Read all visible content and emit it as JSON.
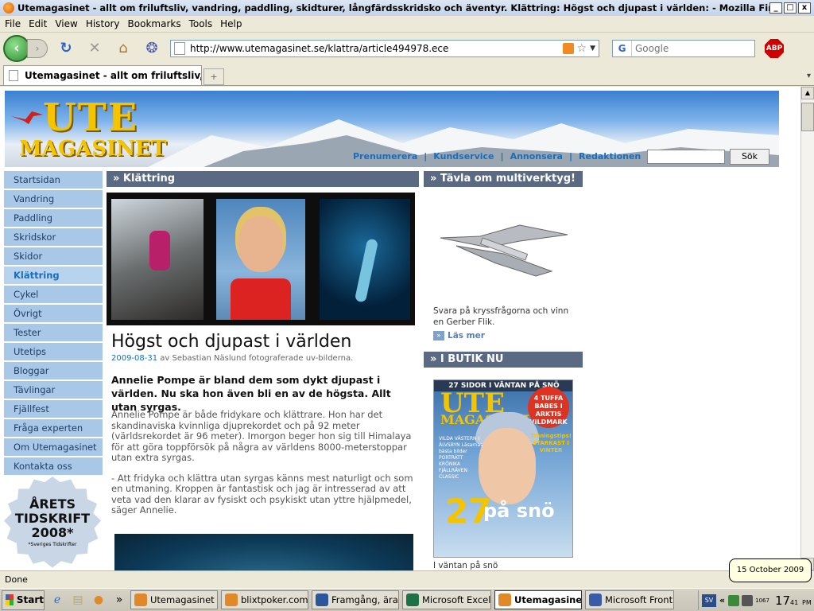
{
  "window": {
    "title": "Utemagasinet - allt om friluftsliv, vandring, paddling, skidturer, långfärdsskridsko och äventyr. Klättring: Högst och djupast i världen: - Mozilla Firefox",
    "controls": [
      "_",
      "□",
      "x"
    ]
  },
  "menu": [
    "File",
    "Edit",
    "View",
    "History",
    "Bookmarks",
    "Tools",
    "Help"
  ],
  "toolbar": {
    "url": "http://www.utemagasinet.se/klattra/article494978.ece",
    "search_engine": "G",
    "search_placeholder": "Google",
    "adblock_label": "ABP"
  },
  "tabs": [
    {
      "label": "Utemagasinet - allt om friluftsliv, va..."
    }
  ],
  "site": {
    "logo_top": "UTE",
    "logo_bottom": "MAGASINET",
    "topnav": [
      "Prenumerera",
      "Kundservice",
      "Annonsera",
      "Redaktionen"
    ],
    "search_button": "Sök",
    "leftnav": [
      {
        "label": "Startsidan",
        "active": false
      },
      {
        "label": "Vandring",
        "active": false
      },
      {
        "label": "Paddling",
        "active": false
      },
      {
        "label": "Skridskor",
        "active": false
      },
      {
        "label": "Skidor",
        "active": false
      },
      {
        "label": "Klättring",
        "active": true
      },
      {
        "label": "Cykel",
        "active": false
      },
      {
        "label": "Övrigt",
        "active": false
      },
      {
        "label": "Tester",
        "active": false
      },
      {
        "label": "Utetips",
        "active": false
      },
      {
        "label": "Bloggar",
        "active": false
      },
      {
        "label": "Tävlingar",
        "active": false
      },
      {
        "label": "Fjällfest",
        "active": false
      },
      {
        "label": "Fråga experten",
        "active": false
      },
      {
        "label": "Om Utemagasinet",
        "active": false
      },
      {
        "label": "Kontakta oss",
        "active": false
      }
    ],
    "award": {
      "line1": "ÅRETS",
      "line2": "TIDSKRIFT",
      "line3": "2008*",
      "note": "*Sveriges Tidskrifter"
    }
  },
  "article": {
    "section": "» Klättring",
    "title": "Högst och djupast i världen",
    "date": "2009-08-31",
    "byline_rest": " av Sebastian Näslund fotograferade uv-bilderna.",
    "lead": "Annelie Pompe är bland dem som dykt djupast i världen. Nu ska hon även bli en av de högsta. Allt utan syrgas.",
    "paragraphs": [
      "Annelie Pompe är både fridykare och klättrare. Hon har det skandinaviska kvinnliga djuprekordet och på 92 meter (världsrekordet är 96 meter). Imorgon beger hon sig till Himalaya för att göra toppförsök på några av världens 8000-meterstoppar utan extra syrgas.",
      "- Att fridyka och klättra utan syrgas känns mest naturligt och som en utmaning. Kroppen är fantastisk och jag är intresserad av att veta vad den klarar av fysiskt och psykiskt utan yttre hjälpmedel, säger Annelie."
    ]
  },
  "sidebar": {
    "contest_head": "» Tävla om multiverktyg!",
    "contest_text": "Svara på kryssfrågorna och vinn en Gerber Flik.",
    "read_more": "Läs mer",
    "shop_head": "» I BUTIK NU",
    "mag_top": "27 SIDOR I VÄNTAN PÅ SNÖ",
    "mag_logo_top": "UTE",
    "mag_logo_bottom": "MAGASINET",
    "mag_badge": "4 TUFFA BABES I ARKTIS VILDMARK",
    "mag_side": "VILDA VÄSTERN I ÄLVSBYN Läsarnas bästa bilder PORTRÄTT KRÖNIKA FJÄLLRÄVEN CLASSIC",
    "mag_start": "Träningstips! STARKAST I VINTER",
    "mag_num": "27",
    "mag_pasno": "på snö",
    "mag_caption": "I väntan på snö"
  },
  "status": {
    "text": "Done",
    "tooltip": "15 October 2009"
  },
  "taskbar": {
    "start": "Start",
    "quicklaunch_more": "»",
    "tasks": [
      {
        "label": "Utemagasinet -...",
        "active": false,
        "color": "#e0892a"
      },
      {
        "label": "blixtpoker.com ...",
        "active": false,
        "color": "#e0892a"
      },
      {
        "label": "Framgång, ära...",
        "active": false,
        "color": "#2b579a"
      },
      {
        "label": "Microsoft Excel...",
        "active": false,
        "color": "#1e7145"
      },
      {
        "label": "Utemagasine...",
        "active": true,
        "color": "#e0892a"
      },
      {
        "label": "Microsoft Front...",
        "active": false,
        "color": "#3a5ca8"
      }
    ],
    "tray_sv": "SV",
    "tray_chevron": "«",
    "tray_counter": "1067",
    "clock_hour": "17",
    "clock_min": "41",
    "clock_ampm": "PM"
  }
}
